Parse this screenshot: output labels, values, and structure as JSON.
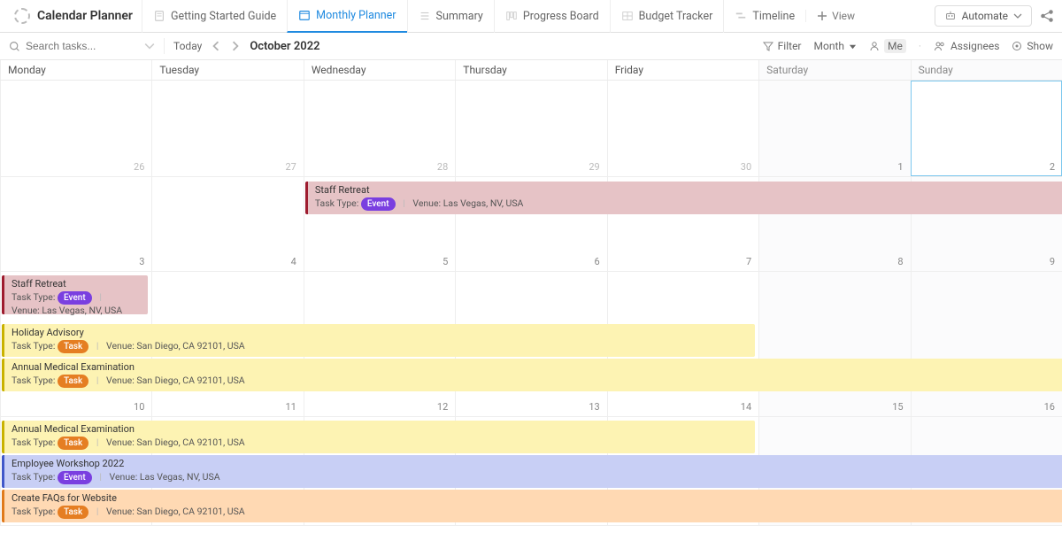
{
  "header": {
    "title": "Calendar Planner",
    "tabs": [
      {
        "label": "Getting Started Guide"
      },
      {
        "label": "Monthly Planner"
      },
      {
        "label": "Summary"
      },
      {
        "label": "Progress Board"
      },
      {
        "label": "Budget Tracker"
      },
      {
        "label": "Timeline"
      }
    ],
    "add_view": "View",
    "automate": "Automate"
  },
  "toolbar": {
    "search_placeholder": "Search tasks...",
    "today": "Today",
    "month_label": "October 2022",
    "filter": "Filter",
    "period": "Month",
    "me": "Me",
    "assignees": "Assignees",
    "show": "Show"
  },
  "days": [
    "Monday",
    "Tuesday",
    "Wednesday",
    "Thursday",
    "Friday",
    "Saturday",
    "Sunday"
  ],
  "weeks": [
    {
      "dates": [
        "26",
        "27",
        "28",
        "29",
        "30",
        "1",
        "2"
      ],
      "dim": [
        true,
        true,
        true,
        true,
        true,
        false,
        false
      ],
      "today": 6
    },
    {
      "dates": [
        "3",
        "4",
        "5",
        "6",
        "7",
        "8",
        "9"
      ]
    },
    {
      "dates": [
        "10",
        "11",
        "12",
        "13",
        "14",
        "15",
        "16"
      ]
    }
  ],
  "labels": {
    "task_type": "Task Type:",
    "venue": "Venue:",
    "event": "Event",
    "task": "Task"
  },
  "events": {
    "w1": {
      "e1": {
        "title": "Staff Retreat",
        "venue": "Las Vegas, NV, USA",
        "badge": "event"
      }
    },
    "w2": {
      "e1": {
        "title": "Staff Retreat",
        "venue": "Las Vegas, NV, USA",
        "badge": "event"
      },
      "e2": {
        "title": "Holiday Advisory",
        "venue": "San Diego, CA 92101, USA",
        "badge": "task"
      },
      "e3": {
        "title": "Annual Medical Examination",
        "venue": "San Diego, CA 92101, USA",
        "badge": "task"
      }
    },
    "w3": {
      "e1": {
        "title": "Annual Medical Examination",
        "venue": "San Diego, CA 92101, USA",
        "badge": "task"
      },
      "e2": {
        "title": "Employee Workshop 2022",
        "venue": "Las Vegas, NV, USA",
        "badge": "event"
      },
      "e3": {
        "title": "Create FAQs for Website",
        "venue": "San Diego, CA 92101, USA",
        "badge": "task"
      }
    }
  }
}
